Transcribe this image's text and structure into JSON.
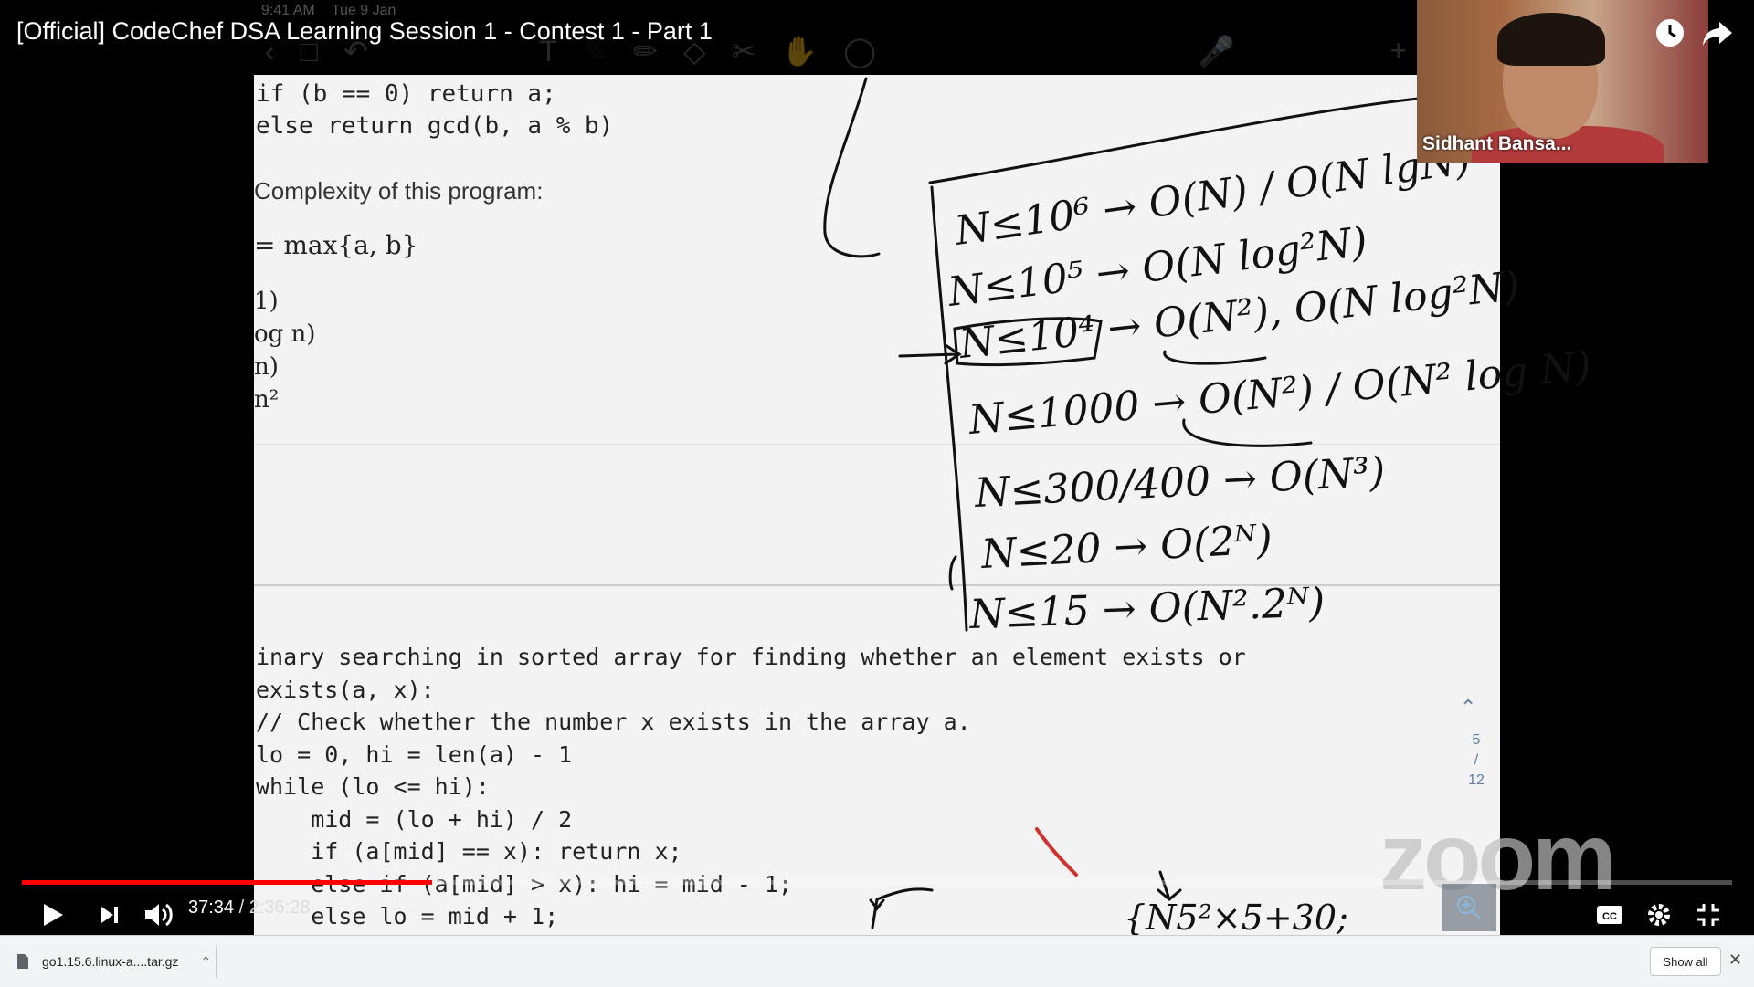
{
  "video": {
    "title": "[Official] CodeChef DSA Learning Session 1 - Contest 1 - Part 1",
    "current_time": "37:34",
    "separator": " / ",
    "duration": "2:36:28",
    "progress_fraction": 0.2401,
    "buffered_fraction": 0.245
  },
  "ipad_status": {
    "time": "9:41 AM",
    "date": "Tue 9 Jan"
  },
  "slide": {
    "top_code": "if (b == 0) return a;\nelse return gcd(b, a % b)",
    "complexity_title": "Complexity of this program:",
    "max_expr": "= max{a, b}",
    "cases": "1)\nog n)\nn)\nn²",
    "bottom_code": "inary searching in sorted array for finding whether an element exists or\nexists(a, x):\n// Check whether the number x exists in the array a.\nlo = 0, hi = len(a) - 1\nwhile (lo <= hi):\n    mid = (lo + hi) / 2\n    if (a[mid] == x): return x;\n    else if (a[mid] > x): hi = mid - 1;\n    else lo = mid + 1;",
    "page_current": "5",
    "page_sep": "/",
    "page_total": "12"
  },
  "handwriting": [
    "N≤10⁶ → O(N) / O(N lgN)",
    "N≤10⁵ → O(N log²N)",
    "N≤10⁴ → O(N²), O(N log²N)",
    "N≤1000 → O(N²) / O(N² log N)",
    "N≤300/400 → O(N³)",
    "N≤20 → O(2ᴺ)",
    "N≤15 → O(N².2ᴺ)",
    "{N5²×5+30;"
  ],
  "webcam": {
    "name": "Sidhant Bansa..."
  },
  "watermark": "zoom",
  "downloads": {
    "file_name": "go1.15.6.linux-a....tar.gz",
    "show_all": "Show all"
  },
  "icons": [
    "clock-icon",
    "share-icon",
    "play-icon",
    "next-icon",
    "volume-icon",
    "captions-icon",
    "settings-icon",
    "exit-fullscreen-icon",
    "zoom-in-icon",
    "file-icon",
    "chevron-up-icon",
    "close-icon"
  ]
}
